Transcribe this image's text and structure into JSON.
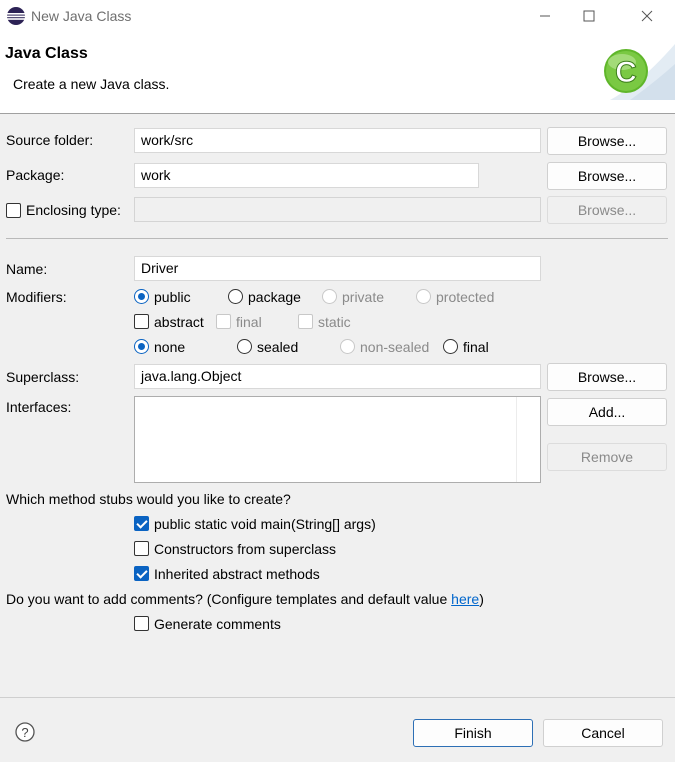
{
  "window": {
    "title": "New Java Class",
    "app_icon": "eclipse-icon",
    "controls": [
      "minimize-icon",
      "maximize-icon",
      "close-icon"
    ]
  },
  "header": {
    "title": "Java Class",
    "description": "Create a new Java class.",
    "banner_icon": "java-class-c-icon"
  },
  "source_folder": {
    "label": "Source folder:",
    "value": "work/src",
    "browse_label": "Browse..."
  },
  "package": {
    "label": "Package:",
    "value": "work",
    "browse_label": "Browse..."
  },
  "enclosing_type": {
    "label": "Enclosing type:",
    "checked": false,
    "value": "",
    "browse_label": "Browse...",
    "browse_enabled": false
  },
  "name": {
    "label": "Name:",
    "value": "Driver"
  },
  "modifiers": {
    "label": "Modifiers:",
    "access": [
      {
        "label": "public",
        "checked": true,
        "enabled": true
      },
      {
        "label": "package",
        "checked": false,
        "enabled": true
      },
      {
        "label": "private",
        "checked": false,
        "enabled": false
      },
      {
        "label": "protected",
        "checked": false,
        "enabled": false
      }
    ],
    "flags": [
      {
        "label": "abstract",
        "checked": false,
        "enabled": true
      },
      {
        "label": "final",
        "checked": false,
        "enabled": false
      },
      {
        "label": "static",
        "checked": false,
        "enabled": false
      }
    ],
    "sealing": [
      {
        "label": "none",
        "checked": true,
        "enabled": true
      },
      {
        "label": "sealed",
        "checked": false,
        "enabled": true
      },
      {
        "label": "non-sealed",
        "checked": false,
        "enabled": false
      },
      {
        "label": "final",
        "checked": false,
        "enabled": true
      }
    ]
  },
  "superclass": {
    "label": "Superclass:",
    "value": "java.lang.Object",
    "browse_label": "Browse..."
  },
  "interfaces": {
    "label": "Interfaces:",
    "items": [],
    "add_label": "Add...",
    "remove_label": "Remove",
    "remove_enabled": false
  },
  "method_stubs": {
    "question": "Which method stubs would you like to create?",
    "options": [
      {
        "label": "public static void main(String[] args)",
        "checked": true
      },
      {
        "label": "Constructors from superclass",
        "checked": false
      },
      {
        "label": "Inherited abstract methods",
        "checked": true
      }
    ]
  },
  "comments": {
    "question": "Do you want to add comments? (Configure templates and default value ",
    "link_text": "here",
    "question_end": ")",
    "option_label": "Generate comments",
    "checked": false
  },
  "footer": {
    "help_icon": "help-icon",
    "finish_label": "Finish",
    "cancel_label": "Cancel"
  }
}
